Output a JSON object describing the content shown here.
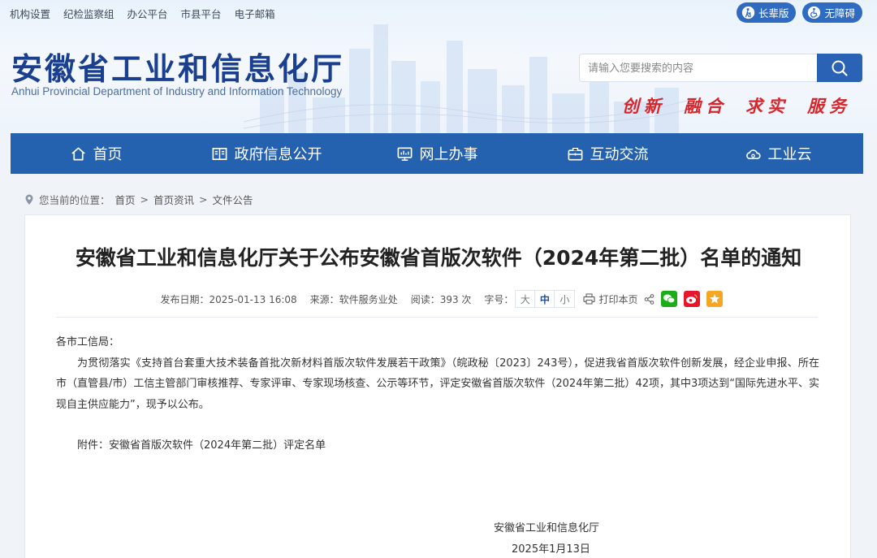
{
  "top_links": [
    "机构设置",
    "纪检监察组",
    "办公平台",
    "市县平台",
    "电子邮箱"
  ],
  "elder_mode": "长辈版",
  "accessibility": "无障碍",
  "site_title": "安徽省工业和信息化厅",
  "site_subtitle": "Anhui Provincial Department of Industry and Information Technology",
  "search_placeholder": "请输入您要搜索的内容",
  "slogan": [
    "创新",
    "融合",
    "求实",
    "服务"
  ],
  "nav": [
    {
      "label": "首页",
      "icon": "home-icon"
    },
    {
      "label": "政府信息公开",
      "icon": "book-icon"
    },
    {
      "label": "网上办事",
      "icon": "monitor-icon"
    },
    {
      "label": "互动交流",
      "icon": "briefcase-icon"
    },
    {
      "label": "工业云",
      "icon": "cloud-icon"
    }
  ],
  "breadcrumb": {
    "prefix": "您当前的位置：",
    "items": [
      "首页",
      "首页资讯",
      "文件公告"
    ],
    "separator": ">"
  },
  "article": {
    "title": "安徽省工业和信息化厅关于公布安徽省首版次软件（2024年第二批）名单的通知",
    "publish_date": "发布日期：2025-01-13 16:08",
    "source": "来源：软件服务业处",
    "views": "阅读：393 次",
    "font_size_label": "字号：",
    "font_sizes": [
      "大",
      "中",
      "小"
    ],
    "font_size_selected": "中",
    "print_label": "打印本页",
    "salutation": "各市工信局：",
    "paragraph": "为贯彻落实《支持首台套重大技术装备首批次新材料首版次软件发展若干政策》（皖政秘〔2023〕243号），促进我省首版次软件创新发展，经企业申报、所在市（直管县/市）工信主管部门审核推荐、专家评审、专家现场核查、公示等环节，评定安徽省首版次软件（2024年第二批）42项，其中3项达到“国际先进水平、实现自主供应能力”，现予以公布。",
    "attachment": "附件：安徽省首版次软件（2024年第二批）评定名单",
    "signature": "安徽省工业和信息化厅",
    "sign_date": "2025年1月13日"
  },
  "colors": {
    "primary_blue": "#2462b0",
    "title_blue": "#1a3f8f",
    "slogan_red": "#d6262c",
    "wechat_green": "#1aad19",
    "weibo_red": "#e6162d",
    "qzone_orange": "#f5a623"
  }
}
